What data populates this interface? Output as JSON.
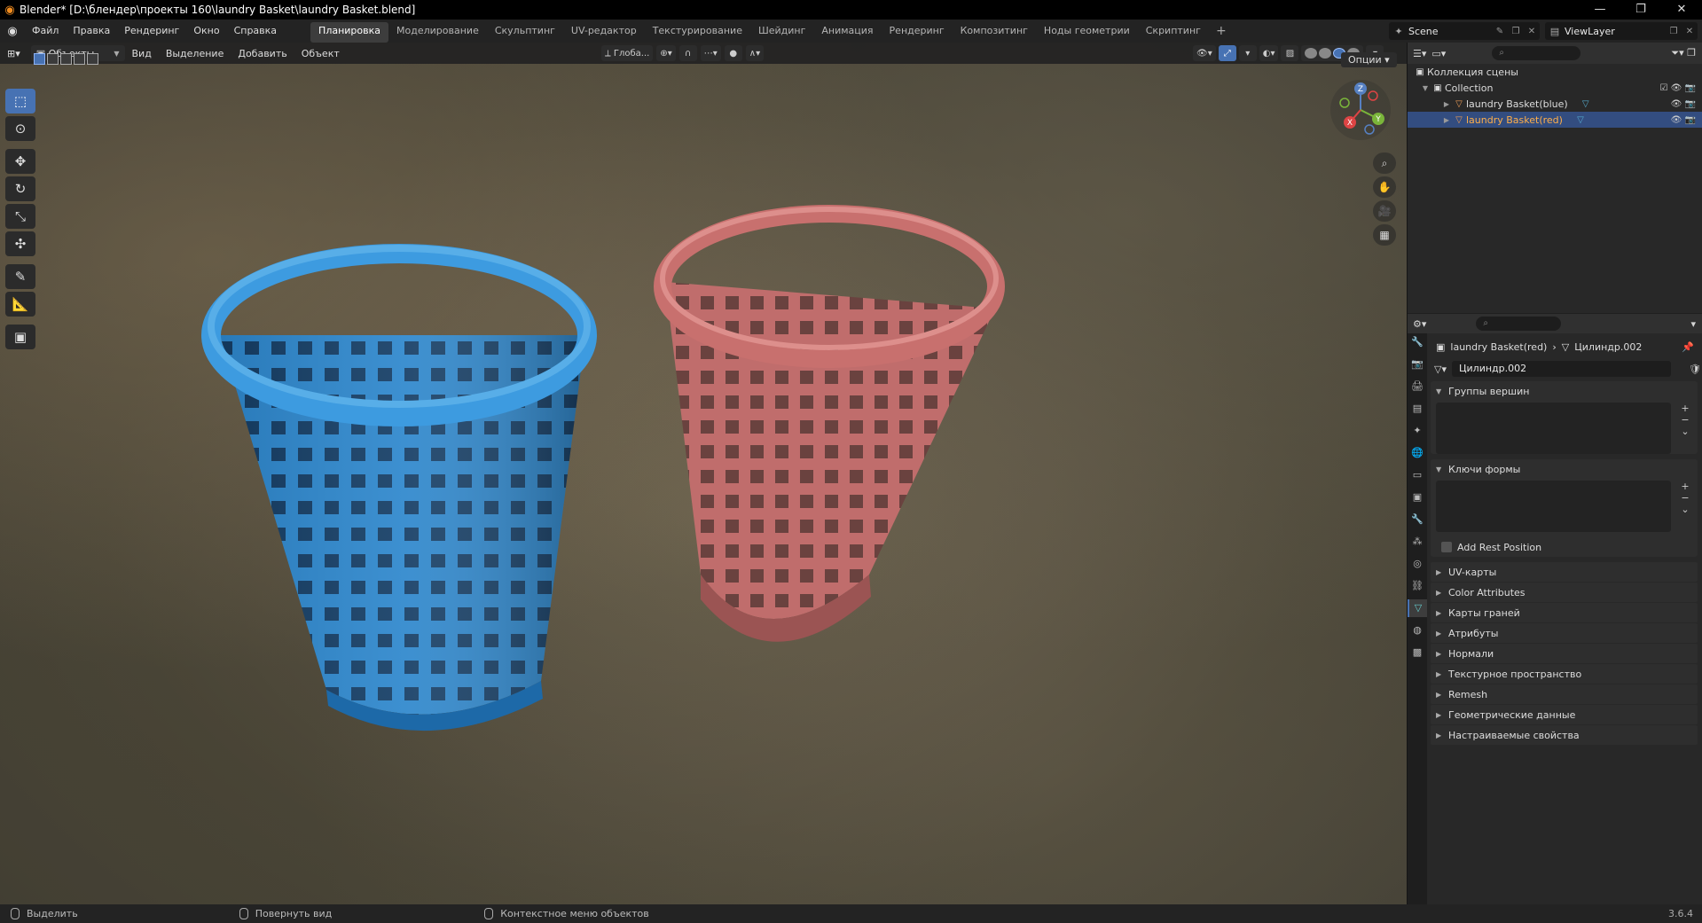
{
  "window": {
    "title": "Blender* [D:\\блендер\\проекты 160\\laundry Basket\\laundry Basket.blend]",
    "controls": [
      "—",
      "❐",
      "✕"
    ]
  },
  "menu": [
    "Файл",
    "Правка",
    "Рендеринг",
    "Окно",
    "Справка"
  ],
  "workspaces": [
    "Планировка",
    "Моделирование",
    "Скульптинг",
    "UV-редактор",
    "Текстурирование",
    "Шейдинг",
    "Анимация",
    "Рендеринг",
    "Композитинг",
    "Ноды геометрии",
    "Скриптинг"
  ],
  "active_workspace": "Планировка",
  "scene": {
    "name": "Scene",
    "view_layer": "ViewLayer"
  },
  "viewport": {
    "mode": "Объекты",
    "menus": [
      "Вид",
      "Выделение",
      "Добавить",
      "Объект"
    ],
    "transform_orientation": "Глоба...",
    "options": "Опции",
    "gizmo_axes": [
      "X",
      "Y",
      "Z"
    ]
  },
  "toolbar": {
    "tools": [
      "select-box",
      "cursor",
      "move",
      "rotate",
      "scale",
      "transform",
      "annotate",
      "measure",
      "add-cube"
    ]
  },
  "objects": {
    "blue": {
      "color_main": "#2f8fd6",
      "color_dark": "#1d69a8",
      "color_light": "#58aee8"
    },
    "red": {
      "color_main": "#c8706e",
      "color_dark": "#9b5453",
      "color_light": "#dd8f8c"
    }
  },
  "outliner": {
    "root": "Коллекция сцены",
    "collection": "Collection",
    "items": [
      {
        "label": "laundry Basket(blue)",
        "selected": false
      },
      {
        "label": "laundry Basket(red)",
        "selected": true
      }
    ]
  },
  "properties": {
    "object_name": "laundry Basket(red)",
    "mesh_name": "Цилиндр.002",
    "mesh_field": "Цилиндр.002",
    "sections": {
      "vertex_groups": "Группы вершин",
      "shape_keys": "Ключи формы",
      "add_rest_position": "Add Rest Position"
    },
    "collapsed": [
      "UV-карты",
      "Color Attributes",
      "Карты граней",
      "Атрибуты",
      "Нормали",
      "Текстурное пространство",
      "Remesh",
      "Геометрические данные",
      "Настраиваемые свойства"
    ]
  },
  "statusbar": {
    "select": "Выделить",
    "rotate": "Повернуть вид",
    "context": "Контекстное меню объектов",
    "version": "3.6.4"
  }
}
